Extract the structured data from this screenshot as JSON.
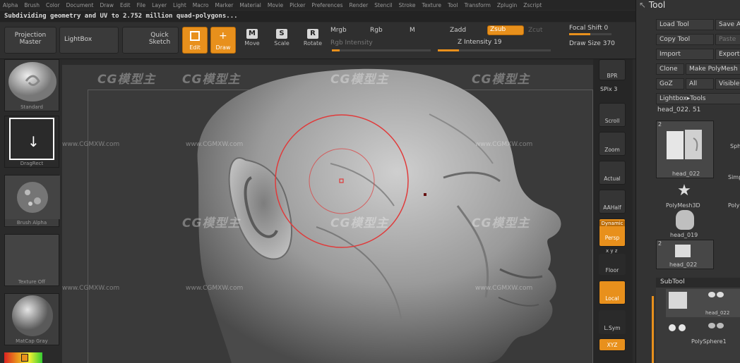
{
  "menu": [
    "Alpha",
    "Brush",
    "Color",
    "Document",
    "Draw",
    "Edit",
    "File",
    "Layer",
    "Light",
    "Macro",
    "Marker",
    "Material",
    "Movie",
    "Picker",
    "Preferences",
    "Render",
    "Stencil",
    "Stroke",
    "Texture",
    "Tool",
    "Transform",
    "Zplugin",
    "Zscript"
  ],
  "status": "Subdividing geometry and UV to 2.752 million quad-polygons...",
  "toolbar": {
    "projection_master": "Projection Master",
    "lightbox": "LightBox",
    "quick_sketch": "Quick Sketch",
    "edit": "Edit",
    "draw": "Draw",
    "move": "Move",
    "scale": "Scale",
    "rotate": "Rotate",
    "move_glyph": "M",
    "scale_glyph": "S",
    "rotate_glyph": "R",
    "mrgb": "Mrgb",
    "rgb": "Rgb",
    "m": "M",
    "rgb_intensity": "Rgb Intensity",
    "zadd": "Zadd",
    "zsub": "Zsub",
    "zcut": "Zcut",
    "z_intensity_label": "Z Intensity",
    "z_intensity_value": "19",
    "z_intensity_level": 0.19,
    "focal_shift_label": "Focal Shift",
    "focal_shift_value": "0",
    "draw_size_label": "Draw Size",
    "draw_size_value": "370"
  },
  "left_shelf": {
    "brush": "Standard",
    "stroke": "DragRect",
    "alpha": "Brush Alpha",
    "texture": "Texture Off",
    "material": "MatCap Gray"
  },
  "right_strip": {
    "bpr": "BPR",
    "spix_label": "SPix",
    "spix_value": "3",
    "scroll": "Scroll",
    "zoom": "Zoom",
    "actual": "Actual",
    "aahalf": "AAHalf",
    "dynamic": "Dynamic",
    "persp": "Persp",
    "xyz_small": "x y z",
    "floor": "Floor",
    "local": "Local",
    "lsym": "L.Sym",
    "xyz": "XYZ"
  },
  "tool_panel": {
    "title": "Tool",
    "load_tool": "Load Tool",
    "save_as": "Save A",
    "copy_tool": "Copy Tool",
    "paste_tool": "Paste",
    "import": "Import",
    "export": "Export",
    "clone": "Clone",
    "make_polymesh": "Make PolyMesh",
    "goz": "GoZ",
    "all": "All",
    "visible": "Visible",
    "lightbox_tools": "Lightbox▸Tools",
    "current_tool": "head_022. 51",
    "tile_count_1": "2",
    "tile_name_1": "head_022",
    "tile_side_1": "Sph",
    "tile_side_2": "Simp",
    "polymesh3d": "PolyMesh3D",
    "poly_side": "Poly",
    "head_019": "head_019",
    "tile_count_2": "2",
    "head_022b": "head_022",
    "subtool": "SubTool",
    "subtool_item": "head_022",
    "polysphere": "PolySphere1"
  },
  "watermarks": {
    "brand": "CG模型主",
    "url": "www.CGMXW.com"
  },
  "colors": {
    "accent": "#e8901c",
    "brush_ring": "#e03a3a"
  }
}
